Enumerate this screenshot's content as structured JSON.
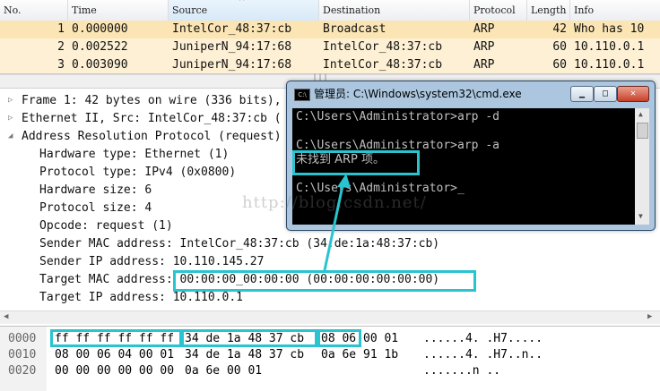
{
  "columns": [
    "No.",
    "Time",
    "Source",
    "Destination",
    "Protocol",
    "Length",
    "Info"
  ],
  "packets": [
    {
      "no": "1",
      "time": "0.000000",
      "source": "IntelCor_48:37:cb",
      "destination": "Broadcast",
      "protocol": "ARP",
      "length": "42",
      "info": "Who has 10"
    },
    {
      "no": "2",
      "time": "0.002522",
      "source": "JuniperN_94:17:68",
      "destination": "IntelCor_48:37:cb",
      "protocol": "ARP",
      "length": "60",
      "info": "10.110.0.1"
    },
    {
      "no": "3",
      "time": "0.003090",
      "source": "JuniperN_94:17:68",
      "destination": "IntelCor_48:37:cb",
      "protocol": "ARP",
      "length": "60",
      "info": "10.110.0.1"
    }
  ],
  "details": {
    "frame": "Frame 1: 42 bytes on wire (336 bits),",
    "ethernet": "Ethernet II, Src: IntelCor_48:37:cb (",
    "arp": "Address Resolution Protocol (request)",
    "fields": [
      "Hardware type: Ethernet (1)",
      "Protocol type: IPv4 (0x0800)",
      "Hardware size: 6",
      "Protocol size: 4",
      "Opcode: request (1)",
      "Sender MAC address: IntelCor_48:37:cb (34:de:1a:48:37:cb)",
      "Sender IP address: 10.110.145.27",
      "Target MAC address: 00:00:00_00:00:00 (00:00:00:00:00:00)",
      "Target IP address: 10.110.0.1"
    ]
  },
  "hex": {
    "rows": [
      {
        "offset": "0000",
        "a": "ff ff ff ff ff ff",
        "b": "34 de  1a 48 37 cb",
        "c": "08 06",
        "d": "00 01",
        "ascii": "......4. .H7....."
      },
      {
        "offset": "0010",
        "a": "08 00 06 04 00 01",
        "b": "34 de  1a 48 37 cb",
        "c": "0a 6e",
        "d": "91 1b",
        "ascii": "......4. .H7..n.."
      },
      {
        "offset": "0020",
        "a": "00 00 00 00 00 00",
        "b": "0a 6e  00 01",
        "c": "",
        "d": "",
        "ascii": ".......n .."
      }
    ]
  },
  "cmd": {
    "title": "管理员: C:\\Windows\\system32\\cmd.exe",
    "lines": [
      "C:\\Users\\Administrator>arp -d",
      "",
      "C:\\Users\\Administrator>arp -a",
      "未找到 ARP 项。",
      "",
      "C:\\Users\\Administrator>_"
    ]
  },
  "watermark": "http://blog.csdn.net/",
  "colors": {
    "highlight": "#29c4cf",
    "row_bg": "#fdf0d4",
    "selected_row": "#fbe5b4"
  }
}
